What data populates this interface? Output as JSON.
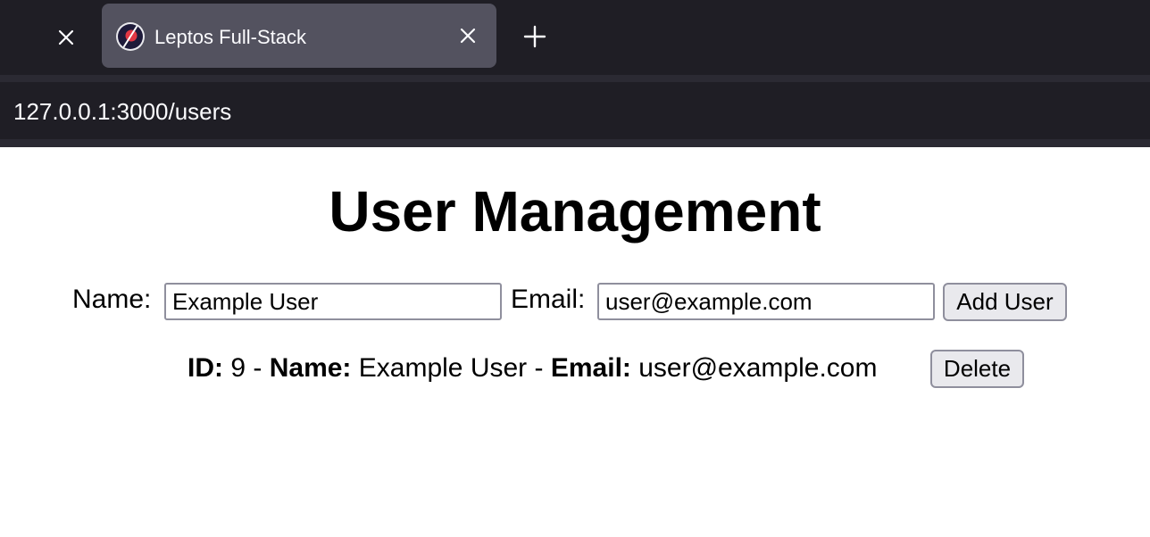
{
  "browser": {
    "tab": {
      "title": "Leptos Full-Stack"
    },
    "url": "127.0.0.1:3000/users",
    "icons": [
      "close-icon",
      "favicon-icon",
      "close-icon",
      "plus-icon"
    ]
  },
  "page": {
    "title": "User Management",
    "form": {
      "name_label": "Name:",
      "name_value": "Example User",
      "email_label": "Email:",
      "email_value": "user@example.com",
      "add_button": "Add User"
    },
    "users": [
      {
        "id_label": "ID:",
        "id": "9",
        "sep1": "-",
        "name_label": "Name:",
        "name": "Example User",
        "sep2": "-",
        "email_label": "Email:",
        "email": "user@example.com",
        "delete_button": "Delete"
      }
    ]
  },
  "colors": {
    "chrome_bg": "#1f1e25",
    "active_tab_bg": "#53525f",
    "button_bg": "#e9e9ed",
    "border": "#8f8f9d"
  }
}
